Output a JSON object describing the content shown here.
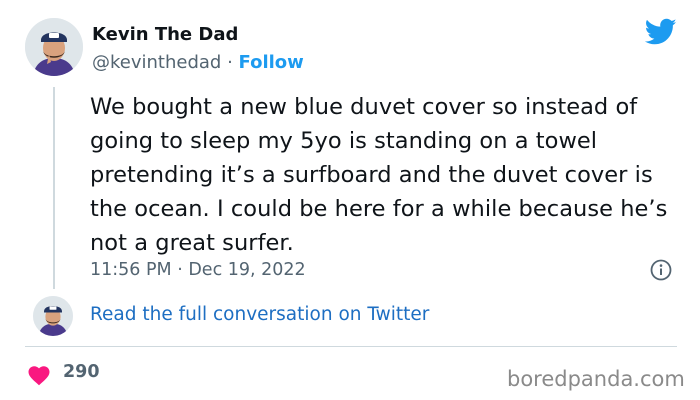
{
  "author": {
    "display_name": "Kevin The Dad",
    "handle": "@kevinthedad",
    "separator": " · ",
    "follow_label": "Follow"
  },
  "tweet": {
    "text": "We bought a new blue duvet cover so instead of going to sleep my 5yo is standing on a towel pretending it’s a surfboard and the duvet cover is the ocean. I could be here for a while because he’s not a great surfer.",
    "timestamp": "11:56 PM · Dec 19, 2022"
  },
  "read_conversation_label": "Read the full conversation on Twitter",
  "likes": {
    "count": "290"
  },
  "watermark": "boredpanda.com",
  "icons": {
    "brand": "twitter-bird-icon",
    "info": "info-icon",
    "like": "heart-icon"
  },
  "colors": {
    "twitter_blue": "#1d9bf0",
    "link_blue": "#1d6ec2",
    "heart_pink": "#f91880",
    "text_primary": "#0f1419",
    "text_secondary": "#536471",
    "divider": "#cfd9de"
  }
}
